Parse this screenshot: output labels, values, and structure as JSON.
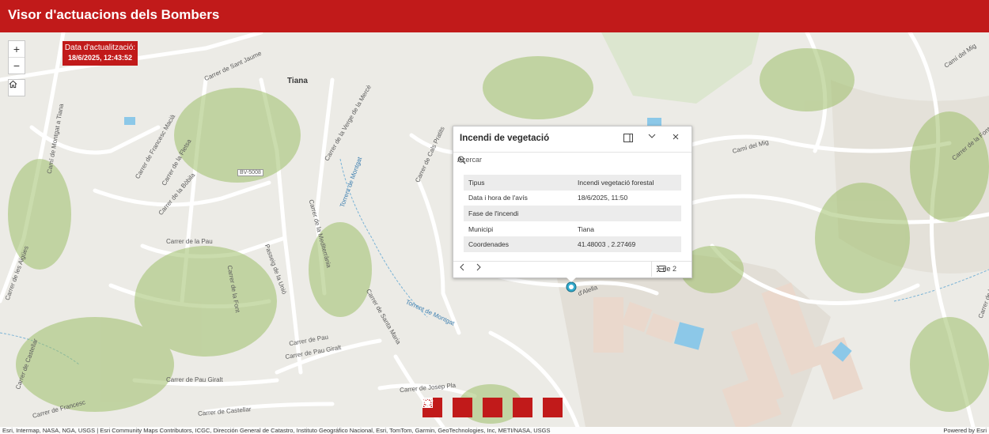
{
  "header": {
    "title": "Visor d'actuacions dels Bombers"
  },
  "update_box": {
    "label": "Data d'actualització:",
    "datetime": "18/6/2025, 12:43:52"
  },
  "map_controls": {
    "zoom_in": "+",
    "zoom_out": "−"
  },
  "map_labels": {
    "town": "Tiana",
    "road_code": "BV-5008",
    "streets": [
      "Carrer de Sant Jaume",
      "Carrer de la Fletsa",
      "Carrer de la Verge de la Mercè",
      "Carrer de Cals Pratits",
      "Carrer de la Pau",
      "Carrer de la Mediterrània",
      "Carrer de Pau",
      "Carrer de Francesc",
      "Passeig de la Unió",
      "Carrer de les Aigües",
      "Carrer de Pau Giralt",
      "Carrer de Pau Giralt",
      "Carrer de Josep Pla",
      "Carrer de Castellar",
      "Camí del Mig",
      "Camí del Mig",
      "Carrer de la Font",
      "Camí de Montgat a Tiana",
      "Carrer de Francesc Macià",
      "Carrer de la Bòbila",
      "Carrer de Santa Maria",
      "Carrer de Castellar",
      "Carrer de Lleida",
      "Carrer de la Fontsanta",
      "d'Alella"
    ],
    "waterways": [
      "Torrent de Montgat",
      "Torrent de Montgat"
    ]
  },
  "popup": {
    "title": "Incendi de vegetació",
    "zoom_to": "Acercar",
    "rows": [
      {
        "key": "Tipus",
        "value": "Incendi vegetació forestal"
      },
      {
        "key": "Data i hora de l'avís",
        "value": "18/6/2025, 11:50"
      },
      {
        "key": "Fase de l'incendi",
        "value": ""
      },
      {
        "key": "Municipi",
        "value": "Tiana"
      },
      {
        "key": "Coordenades",
        "value": "41.48003 , 2.27469"
      }
    ],
    "pagination": "1 de 2"
  },
  "toolbar": [
    "basemap-gallery-icon",
    "layers-icon",
    "legend-icon",
    "filter-icon",
    "info-icon"
  ],
  "footer": {
    "attribution": "Esri, Intermap, NASA, NGA, USGS | Esri Community Maps Contributors, ICGC, Dirección General de Catastro, Instituto Geográfico Nacional, Esri, TomTom, Garmin, GeoTechnologies, Inc, METI/NASA, USGS",
    "powered_by": "Powered by Esri"
  },
  "colors": {
    "brand_red": "#c11a1a",
    "vegetation": "#9fbf6a",
    "water": "#8cc8e8",
    "map_bg": "#ecebe6"
  }
}
